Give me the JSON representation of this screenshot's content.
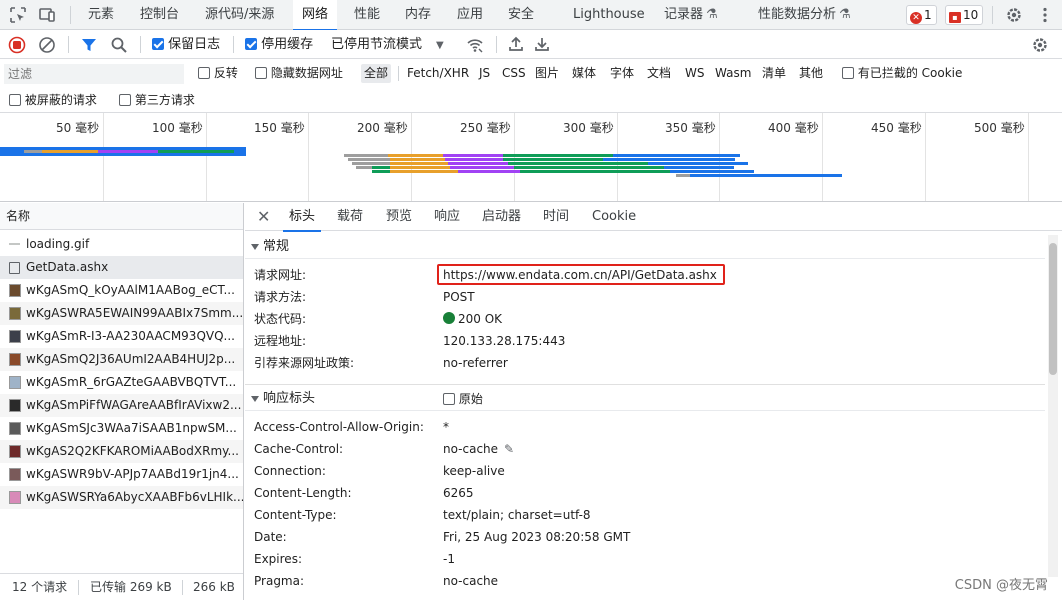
{
  "topbar": {
    "tabs": [
      "元素",
      "控制台",
      "源代码/来源",
      "网络",
      "性能",
      "内存",
      "应用",
      "安全",
      "Lighthouse",
      "记录器",
      "性能数据分析"
    ],
    "active_tab": "网络",
    "error_count": "1",
    "issue_count": "10"
  },
  "toolbar": {
    "preserve_log": "保留日志",
    "disable_cache": "停用缓存",
    "throttle": "已停用节流模式"
  },
  "filter": {
    "placeholder": "过滤",
    "invert": "反转",
    "hide_data_urls": "隐藏数据网址",
    "types": [
      "全部",
      "Fetch/XHR",
      "JS",
      "CSS",
      "图片",
      "媒体",
      "字体",
      "文档",
      "WS",
      "Wasm",
      "清单",
      "其他"
    ],
    "blocked_cookies": "有已拦截的 Cookie",
    "blocked_requests": "被屏蔽的请求",
    "third_party": "第三方请求"
  },
  "overview": {
    "ticks": [
      "50 毫秒",
      "100 毫秒",
      "150 毫秒",
      "200 毫秒",
      "250 毫秒",
      "300 毫秒",
      "350 毫秒",
      "400 毫秒",
      "450 毫秒",
      "500 毫秒"
    ]
  },
  "requests": {
    "header": "名称",
    "items": [
      "loading.gif",
      "GetData.ashx",
      "wKgASmQ_kOyAAlM1AABog_eCT...",
      "wKgASWRA5EWAIN99AABIx7Smm...",
      "wKgASmR-I3-AA230AACM93QVQ...",
      "wKgASmQ2J36AUmI2AAB4HUJ2p...",
      "wKgASmR_6rGAZteGAABVBQTVT...",
      "wKgASmPiFfWAGAreAABfIrAVixw2...",
      "wKgASmSJc3WAa7iSAAB1npwSM...",
      "wKgAS2Q2KFKAROMiAABodXRmy...",
      "wKgASWR9bV-APJp7AABd19r1jn4...",
      "wKgASWSRYa6AbycXAABFb6vLHIk..."
    ],
    "status_count": "12 个请求",
    "status_transferred": "已传输 269 kB",
    "status_size": "266 kB"
  },
  "detail": {
    "tabs": [
      "标头",
      "载荷",
      "预览",
      "响应",
      "启动器",
      "时间",
      "Cookie"
    ],
    "active_tab": "标头",
    "general_title": "常规",
    "general": [
      {
        "k": "请求网址:",
        "v": "https://www.endata.com.cn/API/GetData.ashx"
      },
      {
        "k": "请求方法:",
        "v": "POST"
      },
      {
        "k": "状态代码:",
        "v": "200 OK"
      },
      {
        "k": "远程地址:",
        "v": "120.133.28.175:443"
      },
      {
        "k": "引荐来源网址政策:",
        "v": "no-referrer"
      }
    ],
    "response_title": "响应标头",
    "raw_label": "原始",
    "response": [
      {
        "k": "Access-Control-Allow-Origin:",
        "v": "*"
      },
      {
        "k": "Cache-Control:",
        "v": "no-cache"
      },
      {
        "k": "Connection:",
        "v": "keep-alive"
      },
      {
        "k": "Content-Length:",
        "v": "6265"
      },
      {
        "k": "Content-Type:",
        "v": "text/plain; charset=utf-8"
      },
      {
        "k": "Date:",
        "v": "Fri, 25 Aug 2023 08:20:58 GMT"
      },
      {
        "k": "Expires:",
        "v": "-1"
      },
      {
        "k": "Pragma:",
        "v": "no-cache"
      }
    ]
  },
  "watermark": "CSDN @夜无霄",
  "colors": {
    "accent": "#1a73e8",
    "highlight_box": "#e0221a",
    "status_ok": "#188038"
  }
}
